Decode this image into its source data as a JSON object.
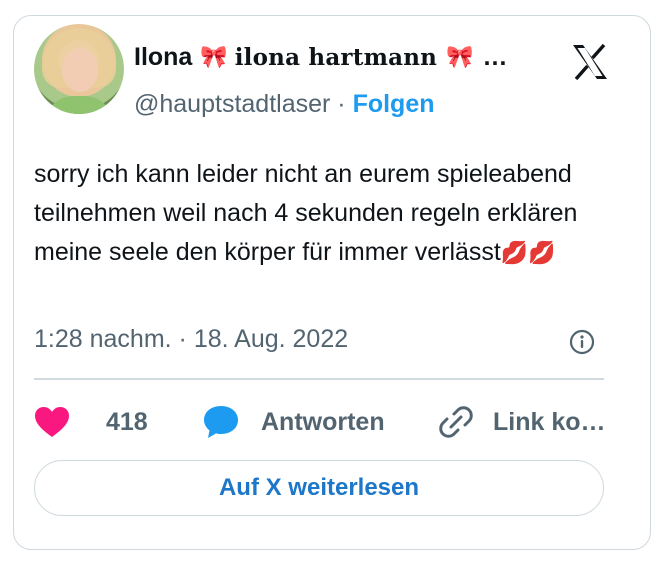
{
  "author": {
    "name": "Ilona",
    "bow_emoji": "🎀",
    "display_name_styled": "ilona hartmann",
    "ellipsis": "…",
    "handle": "@hauptstadtlaser",
    "separator": "·",
    "follow_label": "Folgen"
  },
  "tweet": {
    "text": "sorry ich kann leider nicht an eurem spieleabend teilnehmen weil nach 4 sekunden regeln erklären meine seele den körper für immer verlässt",
    "emoji": "💋💋",
    "time": "1:28 nachm.",
    "date_separator": "·",
    "date": "18. Aug. 2022"
  },
  "actions": {
    "like_count": "418",
    "reply_label": "Antworten",
    "copy_link_label": "Link ko…"
  },
  "read_more_label": "Auf X weiterlesen",
  "icons": {
    "logo": "x-logo-icon",
    "info": "info-icon",
    "heart": "heart-icon",
    "reply": "speech-bubble-icon",
    "link": "link-icon"
  },
  "colors": {
    "accent": "#1d9bf0",
    "heart": "#f91880",
    "bow": "#d7263d",
    "secondary_text": "#536471",
    "border": "#cfd9de"
  }
}
